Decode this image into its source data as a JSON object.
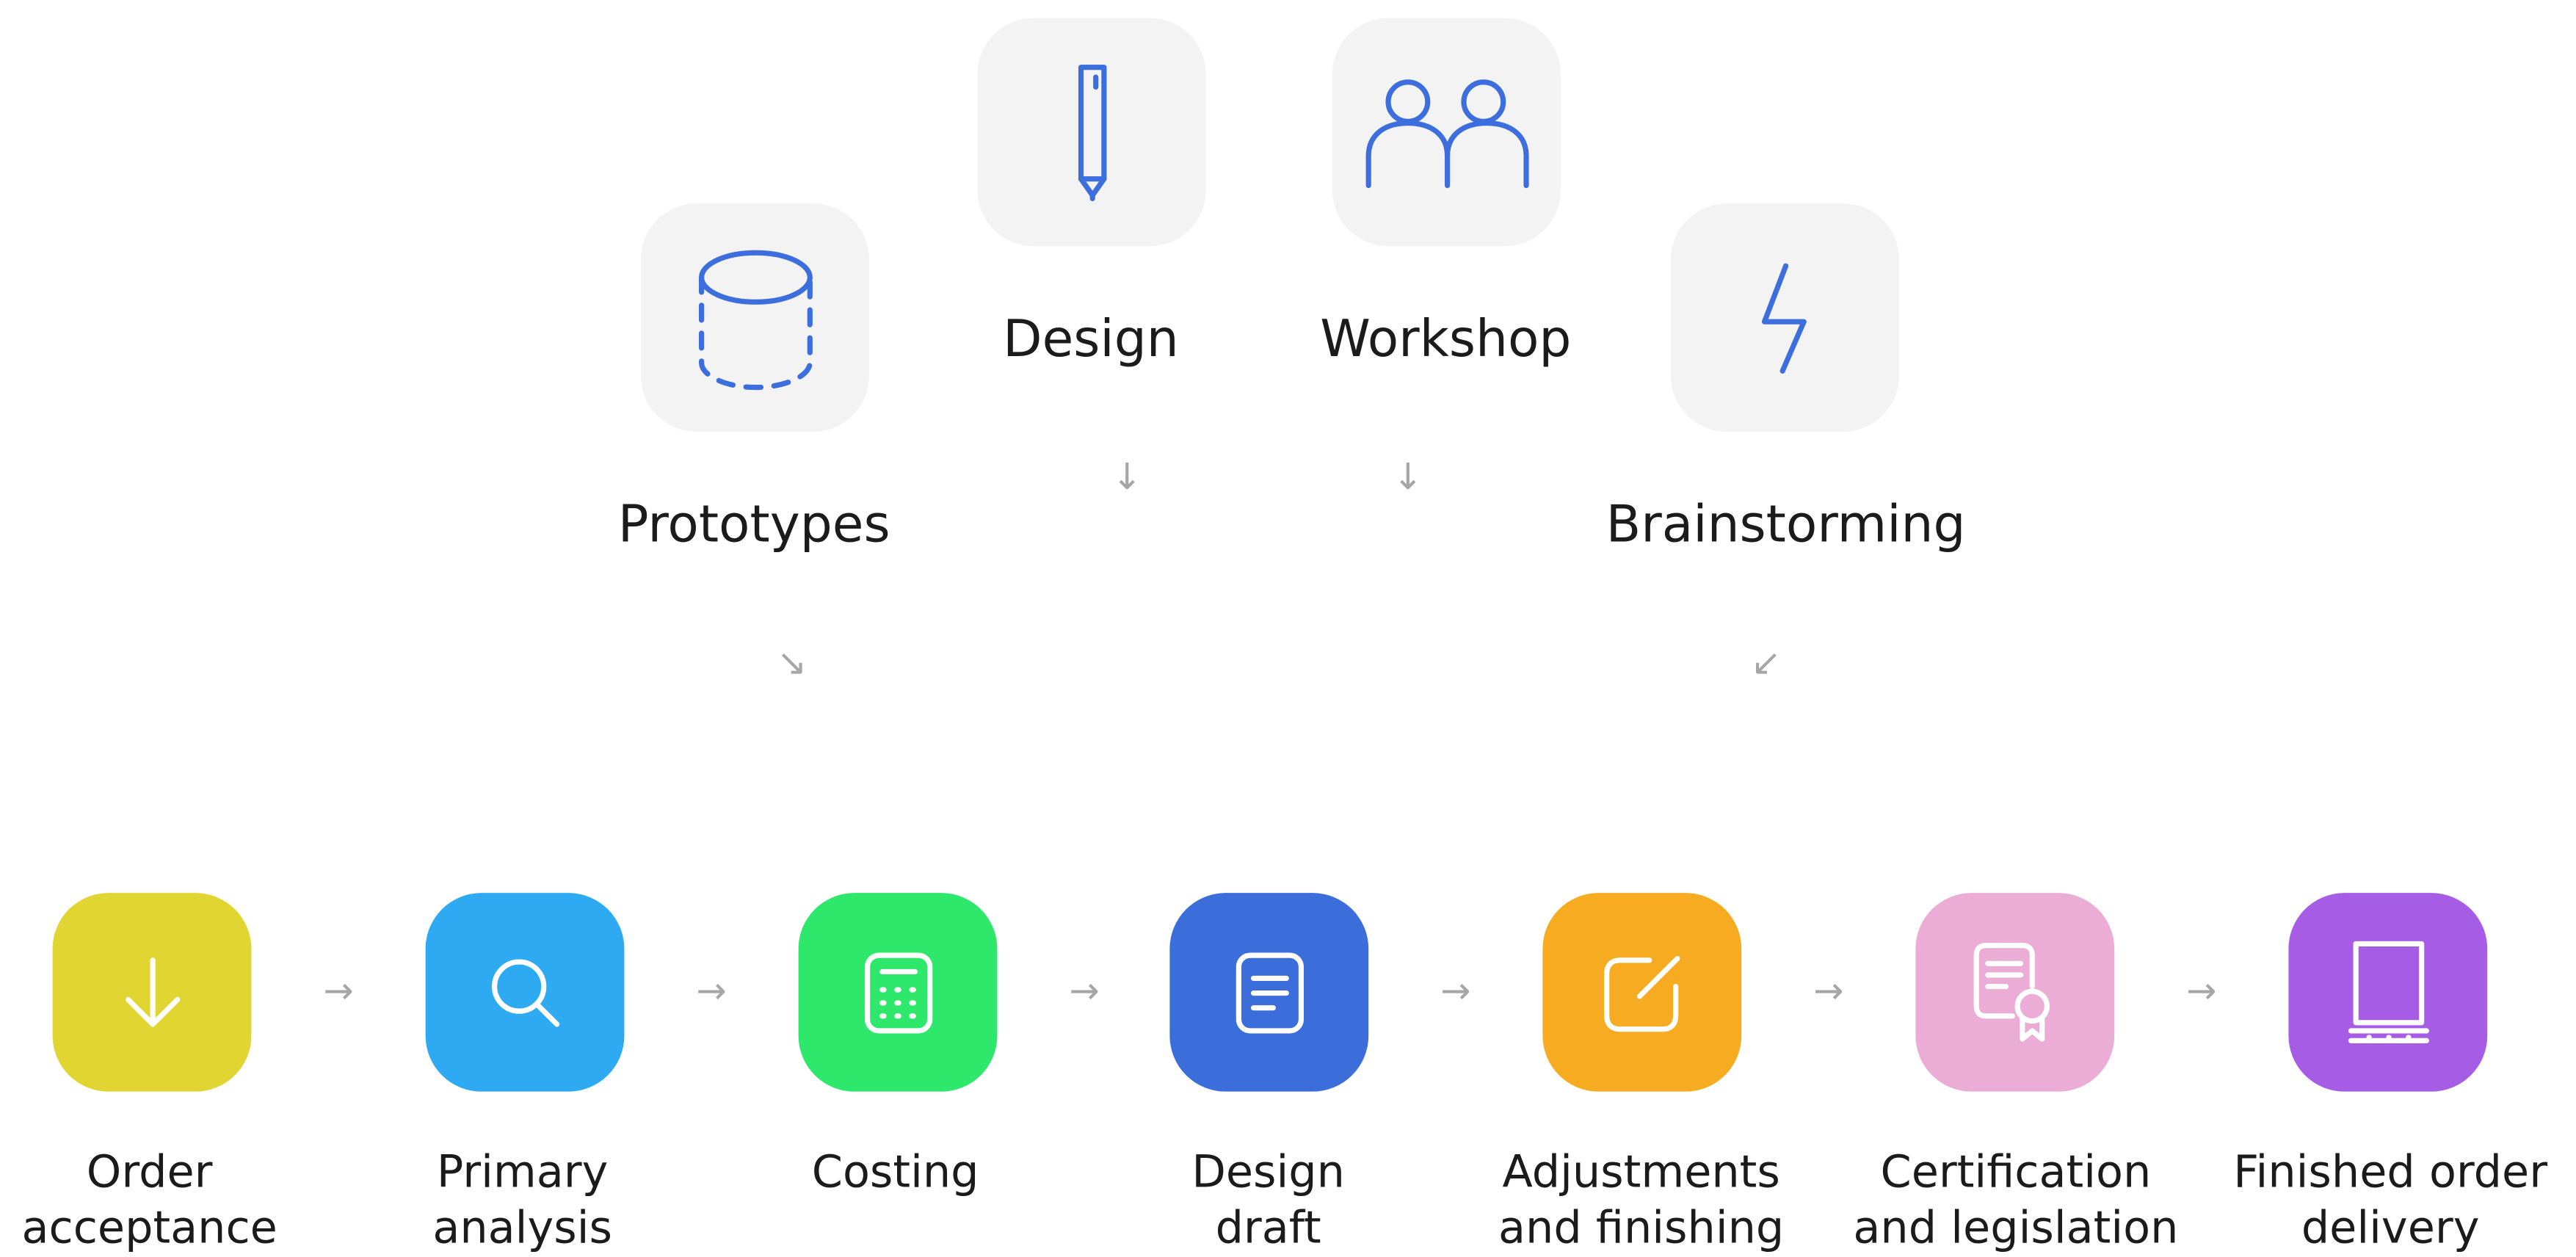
{
  "inputs": [
    {
      "id": "prototypes",
      "label": "Prototypes",
      "icon": "database-icon"
    },
    {
      "id": "design",
      "label": "Design",
      "icon": "pencil-icon"
    },
    {
      "id": "workshop",
      "label": "Workshop",
      "icon": "people-icon"
    },
    {
      "id": "brainstorming",
      "label": "Brainstorming",
      "icon": "lightning-icon"
    }
  ],
  "steps": [
    {
      "label_lines": [
        "Order",
        "acceptance"
      ],
      "icon": "download-arrow-icon",
      "color": "#e0d531"
    },
    {
      "label_lines": [
        "Primary",
        "analysis"
      ],
      "icon": "search-icon",
      "color": "#2eaaf2"
    },
    {
      "label_lines": [
        "Costing",
        ""
      ],
      "icon": "calculator-icon",
      "color": "#2ee86b"
    },
    {
      "label_lines": [
        "Design",
        "draft"
      ],
      "icon": "document-icon",
      "color": "#3b6ddb"
    },
    {
      "label_lines": [
        "Adjustments",
        "and finishing"
      ],
      "icon": "edit-icon",
      "color": "#f7ab20"
    },
    {
      "label_lines": [
        "Certification",
        "and legislation"
      ],
      "icon": "certificate-icon",
      "color": "#ebadd6"
    },
    {
      "label_lines": [
        "Finished order",
        "delivery"
      ],
      "icon": "tablet-icon",
      "color": "#a75ce6"
    }
  ],
  "arrows": {
    "flow": "→",
    "down_right": "↘",
    "down": "↓",
    "down_left": "↙"
  },
  "colors": {
    "input_tile": "#f3f3f3",
    "input_icon": "#3d6ede",
    "arrow": "#a6a6a6",
    "text": "#1b1b1b"
  }
}
